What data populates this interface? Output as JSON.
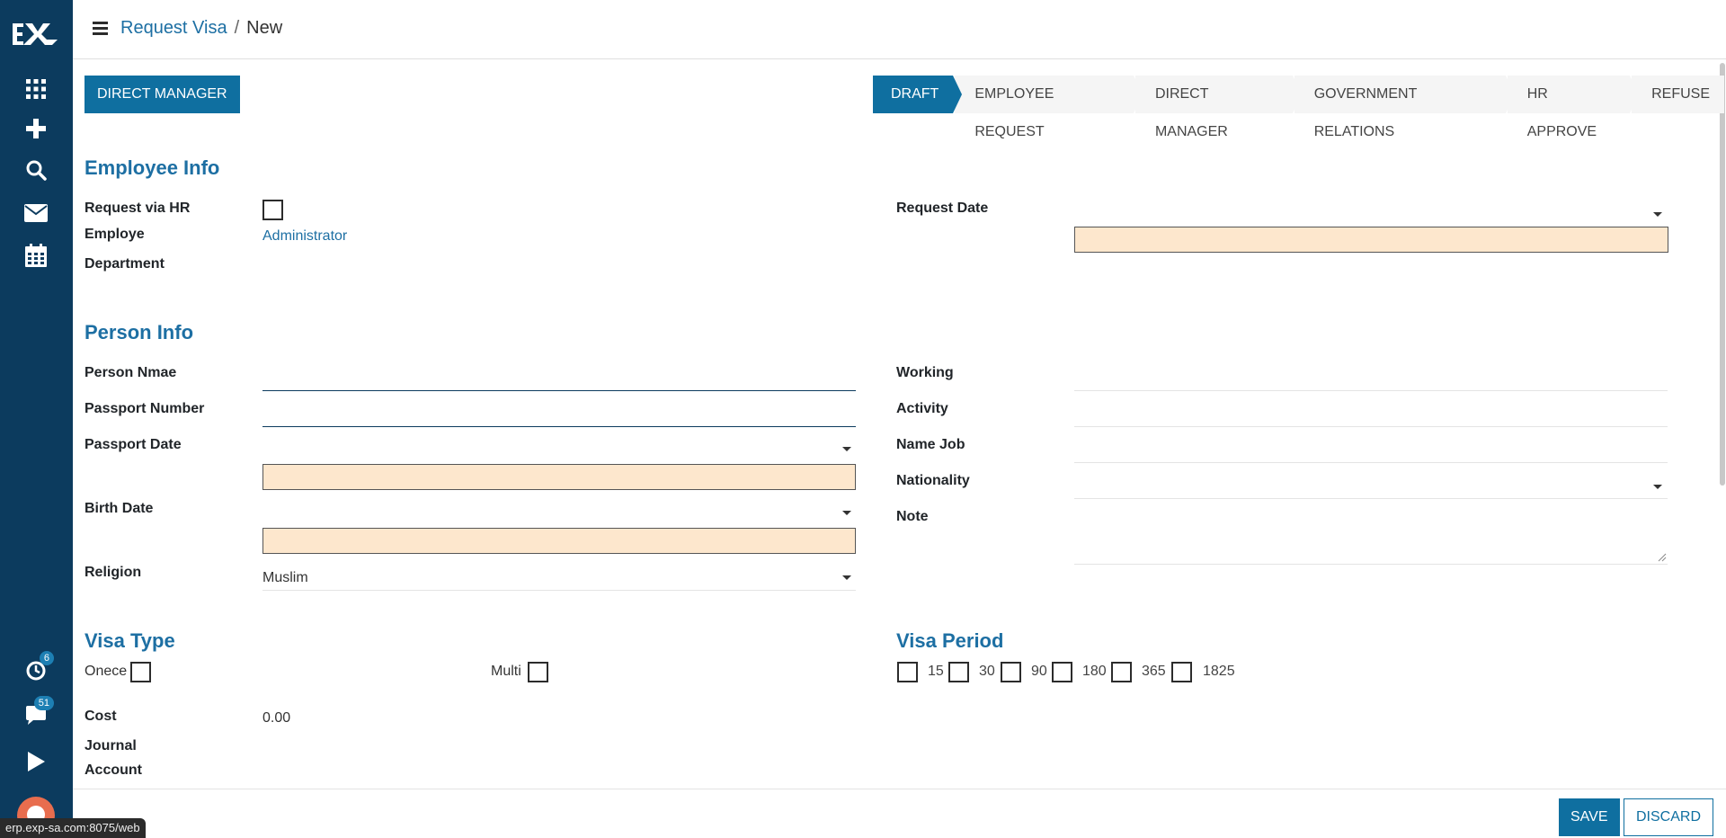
{
  "browser": {
    "status_url": "erp.exp-sa.com:8075/web"
  },
  "breadcrumb": {
    "parent": "Request Visa",
    "separator": "/",
    "current": "New"
  },
  "sidebar": {
    "badges": {
      "activity": "6",
      "messages": "51"
    },
    "icons": [
      "apps-icon",
      "plus-icon",
      "search-icon",
      "mail-icon",
      "calendar-icon",
      "clock-icon",
      "chat-icon",
      "play-icon"
    ]
  },
  "header_button": "DIRECT MANAGER",
  "statusbar": [
    "DRAFT",
    "EMPLOYEE REQUEST",
    "DIRECT MANAGER",
    "GOVERNMENT RELATIONS",
    "HR APPROVE",
    "REFUSE"
  ],
  "employee_info": {
    "title": "Employee Info",
    "request_via_hr_label": "Request via HR",
    "employee_label": "Employe",
    "employee_value": "Administrator",
    "department_label": "Department",
    "request_date_label": "Request Date"
  },
  "person_info": {
    "title": "Person Info",
    "person_name_label": "Person Nmae",
    "passport_number_label": "Passport Number",
    "passport_date_label": "Passport Date",
    "birth_date_label": "Birth Date",
    "religion_label": "Religion",
    "religion_value": "Muslim",
    "working_label": "Working",
    "activity_label": "Activity",
    "name_job_label": "Name Job",
    "nationality_label": "Nationality",
    "note_label": "Note"
  },
  "visa_type": {
    "title": "Visa Type",
    "once_label": "Onece",
    "multi_label": "Multi",
    "cost_label": "Cost",
    "cost_value": "0.00",
    "journal_label": "Journal",
    "account_label": "Account"
  },
  "visa_period": {
    "title": "Visa Period",
    "options": [
      "15",
      "30",
      "90",
      "180",
      "365",
      "1825"
    ]
  },
  "footer": {
    "save": "SAVE",
    "discard": "DISCARD"
  },
  "colors": {
    "sidebar": "#0c3b5e",
    "primary": "#0f6fa0",
    "required": "#fde7cd",
    "section": "#1d6fa3"
  }
}
